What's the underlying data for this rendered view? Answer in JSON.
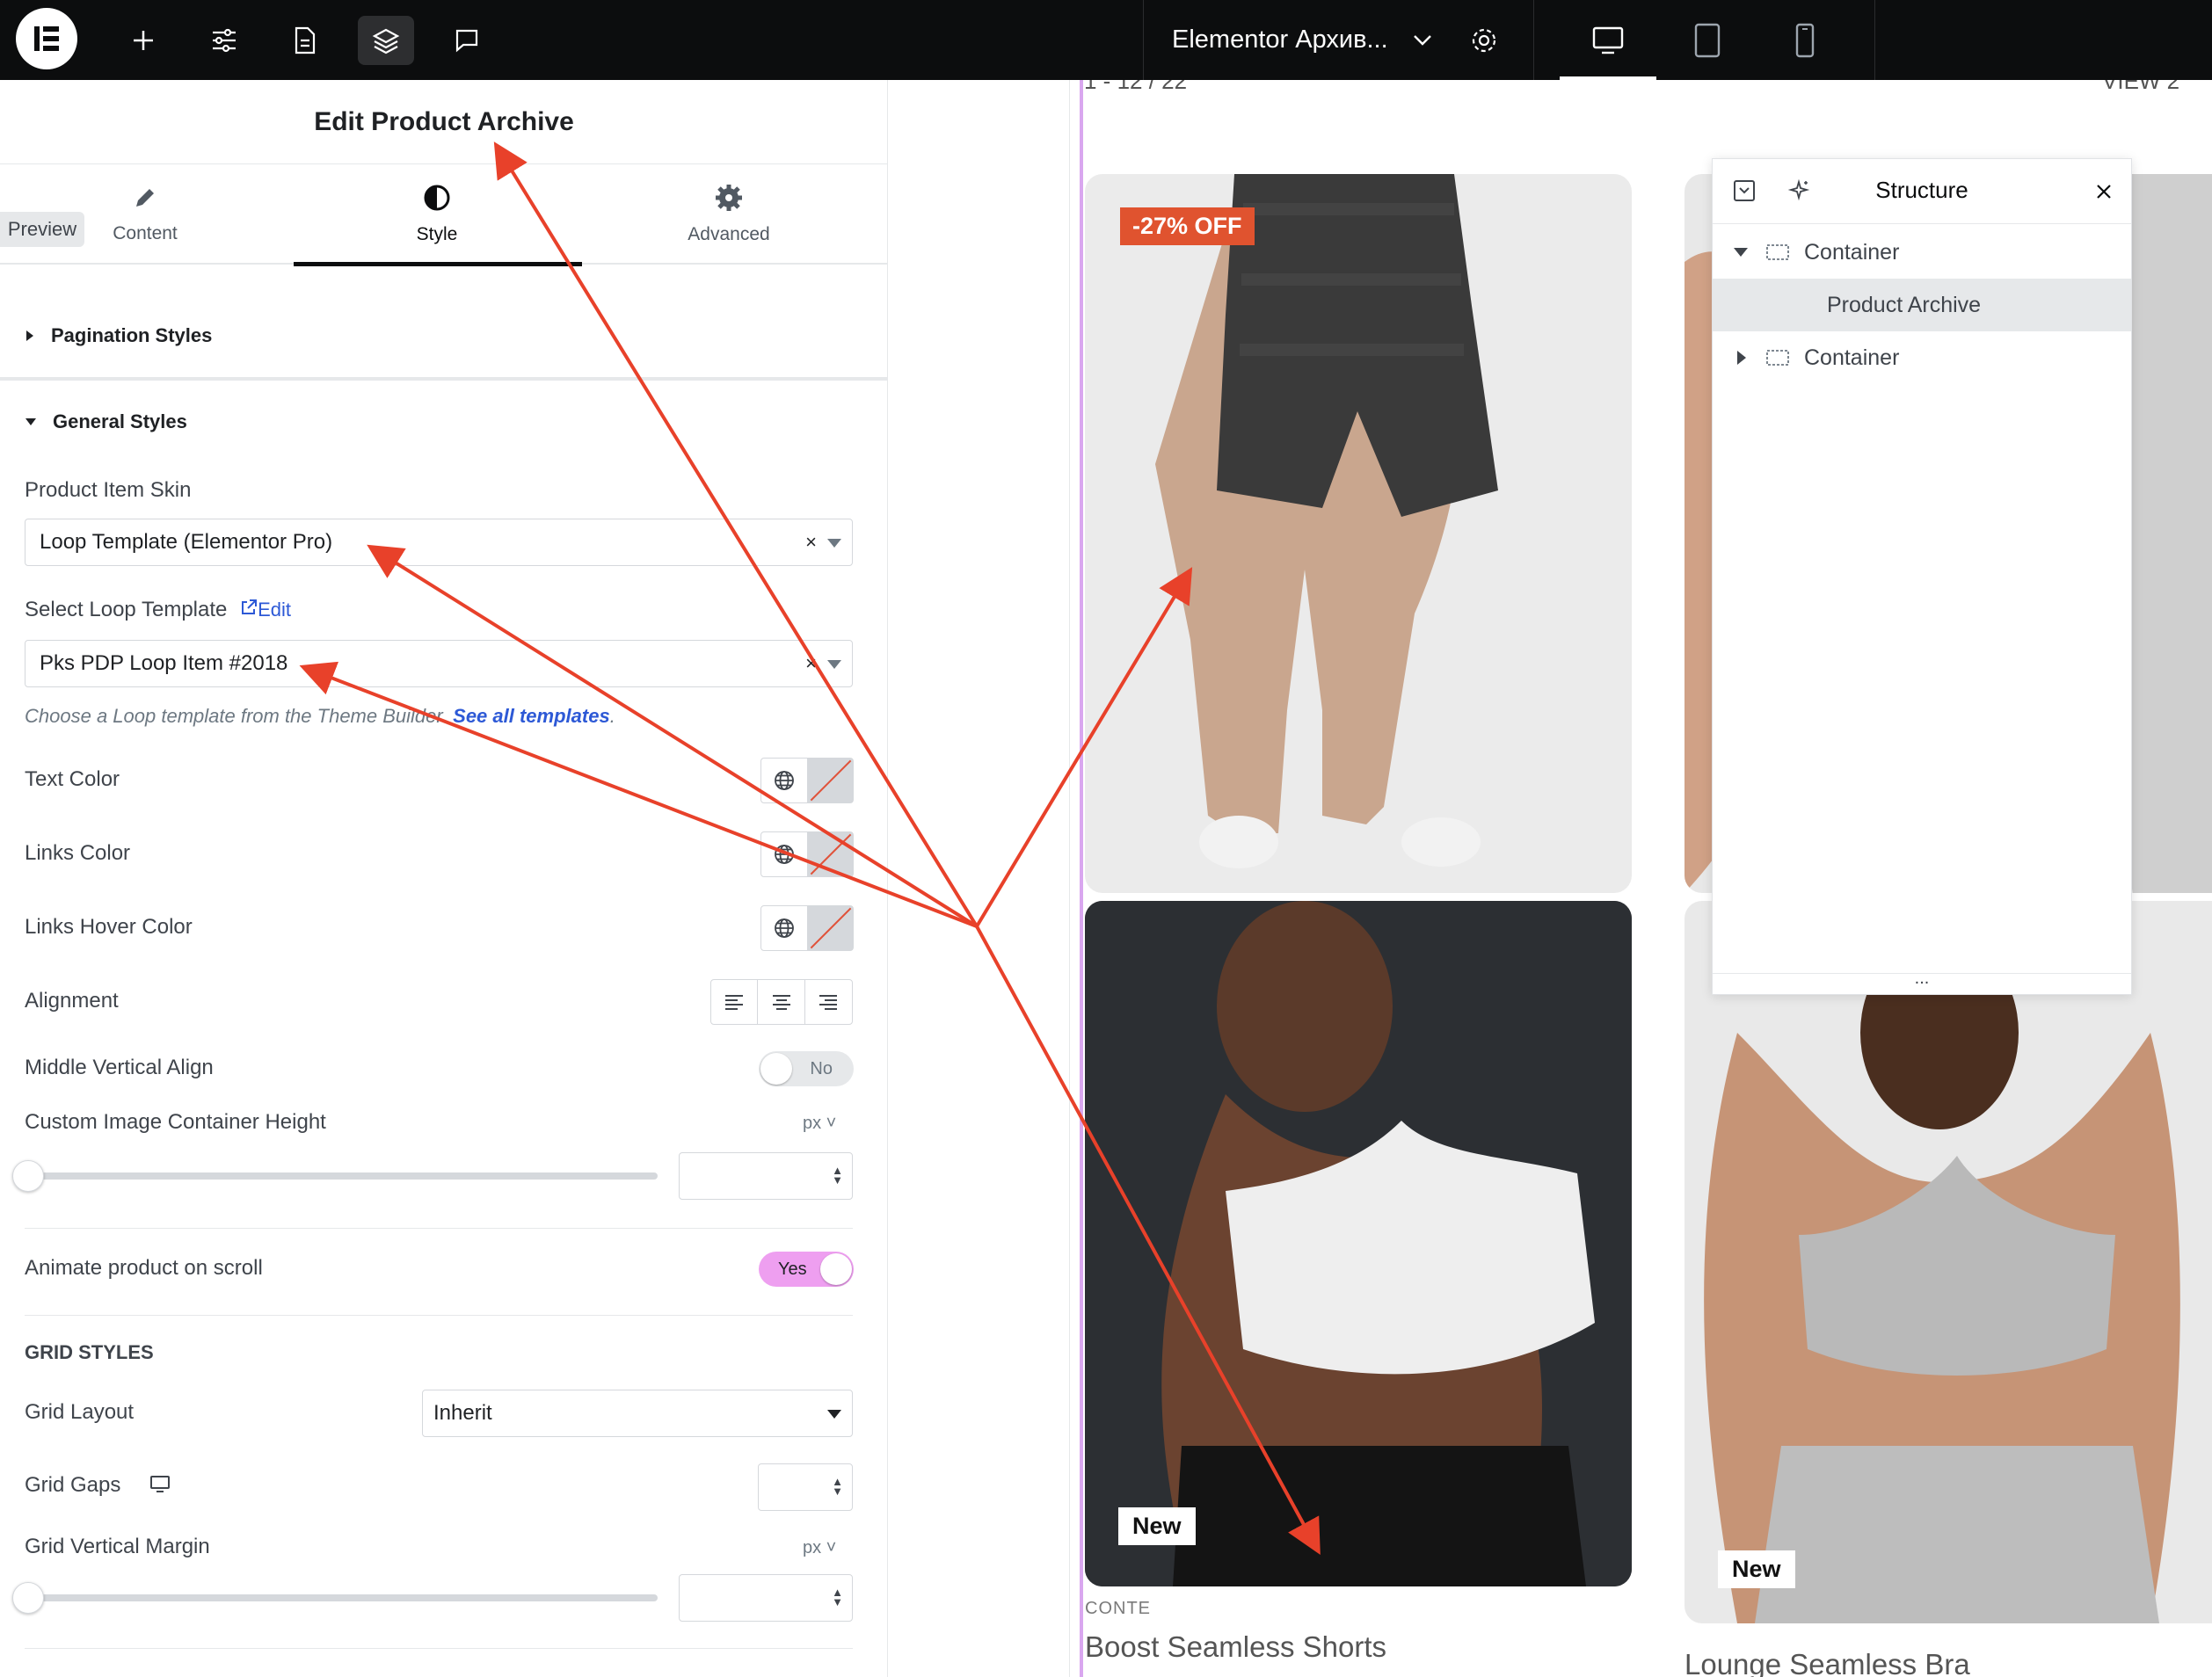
{
  "topbar": {
    "document_title": "Elementor Архив...",
    "accent": "#0c0d0e"
  },
  "panel": {
    "title": "Edit Product Archive",
    "preview_tag": "Preview",
    "tabs": [
      {
        "label": "Content",
        "icon": "pencil-icon"
      },
      {
        "label": "Style",
        "icon": "half-circle-icon"
      },
      {
        "label": "Advanced",
        "icon": "gear-icon"
      }
    ],
    "sections": {
      "pagination": "Pagination Styles",
      "general": "General Styles"
    },
    "fields": {
      "skin_label": "Product Item Skin",
      "skin_value": "Loop Template (Elementor Pro)",
      "loop_label": "Select Loop Template",
      "loop_edit": "Edit",
      "loop_value": "Pks PDP Loop Item #2018",
      "hint_text": "Choose a Loop template from the Theme Builder.",
      "hint_link": "See all templates",
      "hint_end": ".",
      "text_color": "Text Color",
      "links_color": "Links Color",
      "links_hover": "Links Hover Color",
      "alignment": "Alignment",
      "middle_valign": "Middle Vertical Align",
      "middle_valign_value": "No",
      "img_height": "Custom Image Container Height",
      "img_height_unit": "px",
      "animate": "Animate product on scroll",
      "animate_value": "Yes",
      "grid_head": "GRID STYLES",
      "grid_layout": "Grid Layout",
      "grid_layout_value": "Inherit",
      "grid_gaps": "Grid Gaps",
      "grid_vmargin": "Grid Vertical Margin",
      "grid_vmargin_unit": "px"
    }
  },
  "canvas": {
    "top_left_text": "1 - 12 / 22",
    "top_right_text": "VIEW 2",
    "badge_discount": "-27% OFF",
    "badge_new_1": "New",
    "badge_new_2": "New",
    "product1_cat": "CONTE",
    "product1_title": "Boost Seamless Shorts",
    "product2_title": "Lounge Seamless Bra"
  },
  "structure": {
    "title": "Structure",
    "items": [
      {
        "label": "Container"
      },
      {
        "label": "Product Archive"
      },
      {
        "label": "Container"
      }
    ],
    "footer": "..."
  },
  "colors": {
    "arrow": "#e8412a",
    "toggle_on": "#ee9ff0",
    "link": "#2d59d6",
    "discount_badge": "#e0532f"
  }
}
